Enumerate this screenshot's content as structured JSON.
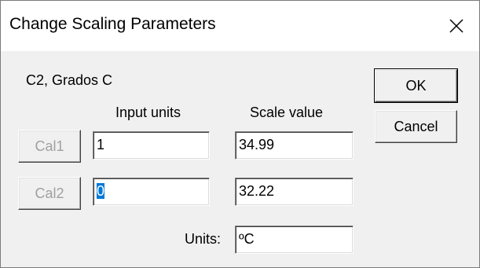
{
  "window": {
    "title": "Change Scaling Parameters"
  },
  "icons": {
    "close": "close-icon"
  },
  "channel_label": "C2, Grados C",
  "columns": {
    "input_units": "Input units",
    "scale_value": "Scale value"
  },
  "rows": [
    {
      "button": "Cal1",
      "input": "1",
      "scale": "34.99"
    },
    {
      "button": "Cal2",
      "input": "0",
      "scale": "32.22"
    }
  ],
  "units": {
    "label": "Units:",
    "value": "ºC"
  },
  "buttons": {
    "ok": "OK",
    "cancel": "Cancel"
  },
  "colors": {
    "dialog_background": "#f0f0f0",
    "selection": "#0078d7"
  }
}
